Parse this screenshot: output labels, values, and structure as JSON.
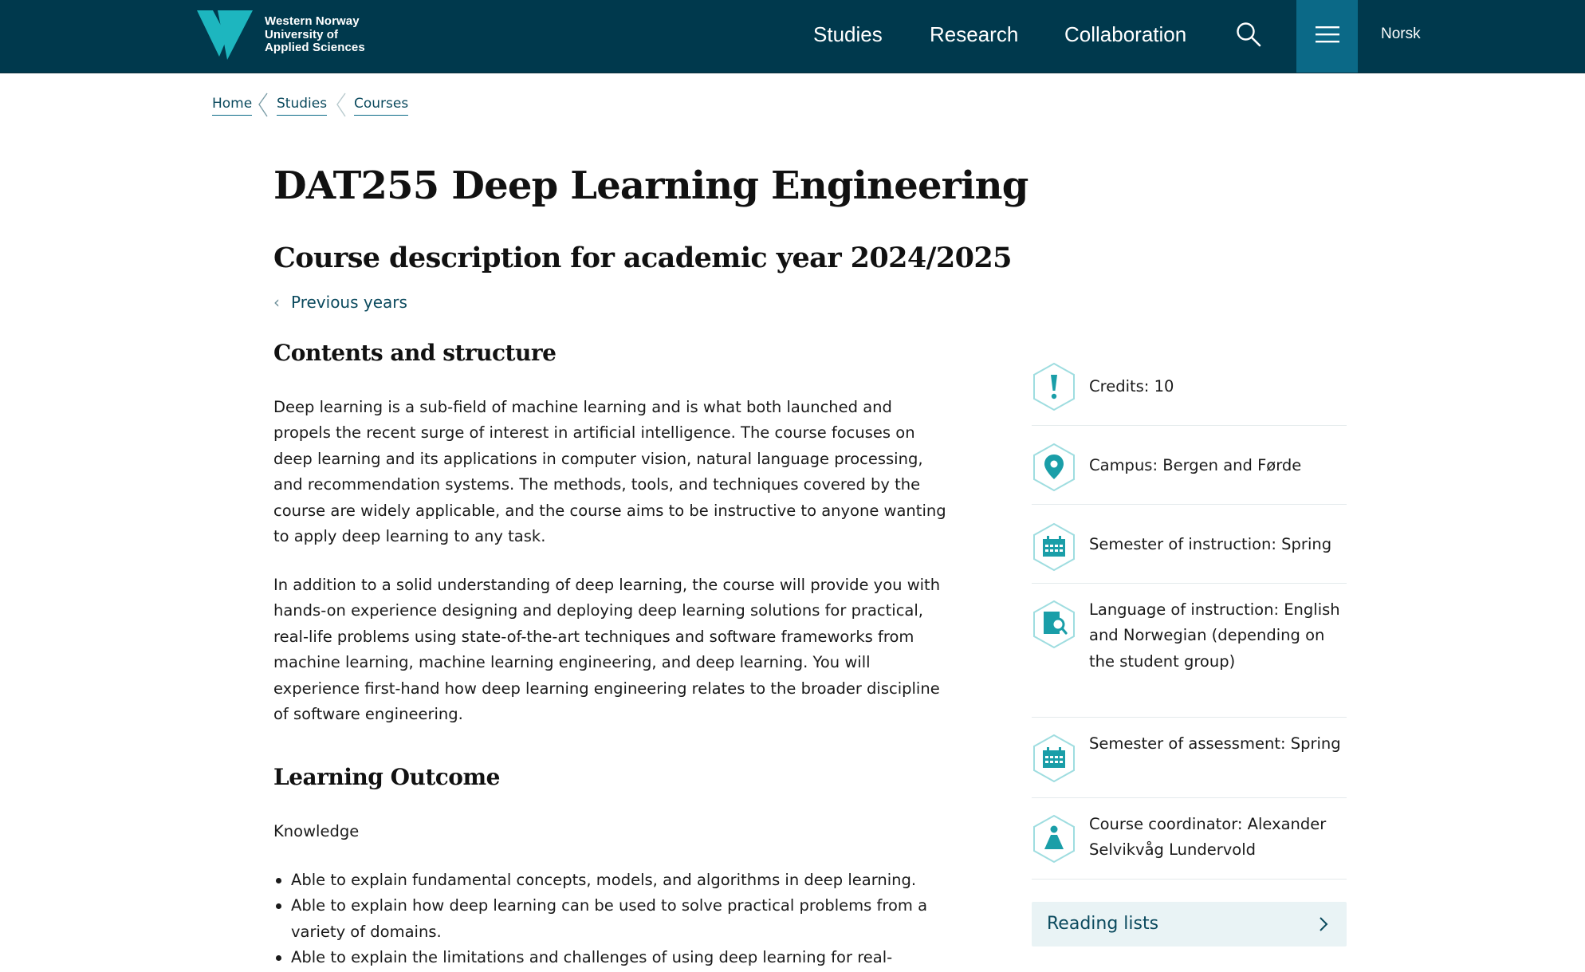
{
  "header": {
    "logo_lines": [
      "Western Norway",
      "University of",
      "Applied Sciences"
    ],
    "nav": [
      {
        "label": "Studies"
      },
      {
        "label": "Research"
      },
      {
        "label": "Collaboration"
      }
    ],
    "language_label": "Norsk",
    "search_icon": "search-icon",
    "menu_icon": "hamburger-menu-icon",
    "brand_color": "#00394d",
    "accent_color": "#1db6bf"
  },
  "breadcrumb": [
    "Home",
    "Studies",
    "Courses"
  ],
  "course": {
    "title": "DAT255 Deep Learning Engineering",
    "subtitle": "Course description for academic year 2024/2025",
    "previous_years_label": "Previous years"
  },
  "contents": {
    "heading": "Contents and structure",
    "paragraphs": [
      "Deep learning is a sub-field of machine learning and is what both launched and propels the recent surge of interest in artificial intelligence. The course focuses on deep learning and its applications in computer vision, natural language processing, and recommendation systems. The methods, tools, and techniques covered by the course are widely applicable, and the course aims to be instructive to anyone wanting to apply deep learning to any task.",
      "In addition to a solid understanding of deep learning, the course will provide you with hands-on experience designing and deploying deep learning solutions for practical, real-life problems using state-of-the-art techniques and software frameworks from machine learning, machine learning engineering, and deep learning. You will experience first-hand how deep learning engineering relates to the broader discipline of software engineering."
    ]
  },
  "learning_outcome": {
    "heading": "Learning Outcome",
    "knowledge_label": "Knowledge",
    "items": [
      "Able to explain fundamental concepts, models, and algorithms in deep learning.",
      "Able to explain how deep learning can be used to solve practical problems from a variety of domains.",
      "Able to explain the limitations and challenges of using deep learning for real-"
    ]
  },
  "facts": [
    {
      "icon": "exclamation-icon",
      "text": "Credits: 10"
    },
    {
      "icon": "location-pin-icon",
      "text": "Campus: Bergen and Førde"
    },
    {
      "icon": "calendar-icon",
      "text": "Semester of instruction: Spring"
    },
    {
      "icon": "language-search-icon",
      "text": "Language of instruction: English and Norwegian (depending on the student group)"
    },
    {
      "icon": "calendar-icon",
      "text": "Semester of assessment: Spring"
    },
    {
      "icon": "person-icon",
      "text": "Course coordinator: Alexander Selvikvåg Lundervold"
    }
  ],
  "reading_lists": {
    "label": "Reading lists",
    "icon": "chevron-right-icon"
  }
}
